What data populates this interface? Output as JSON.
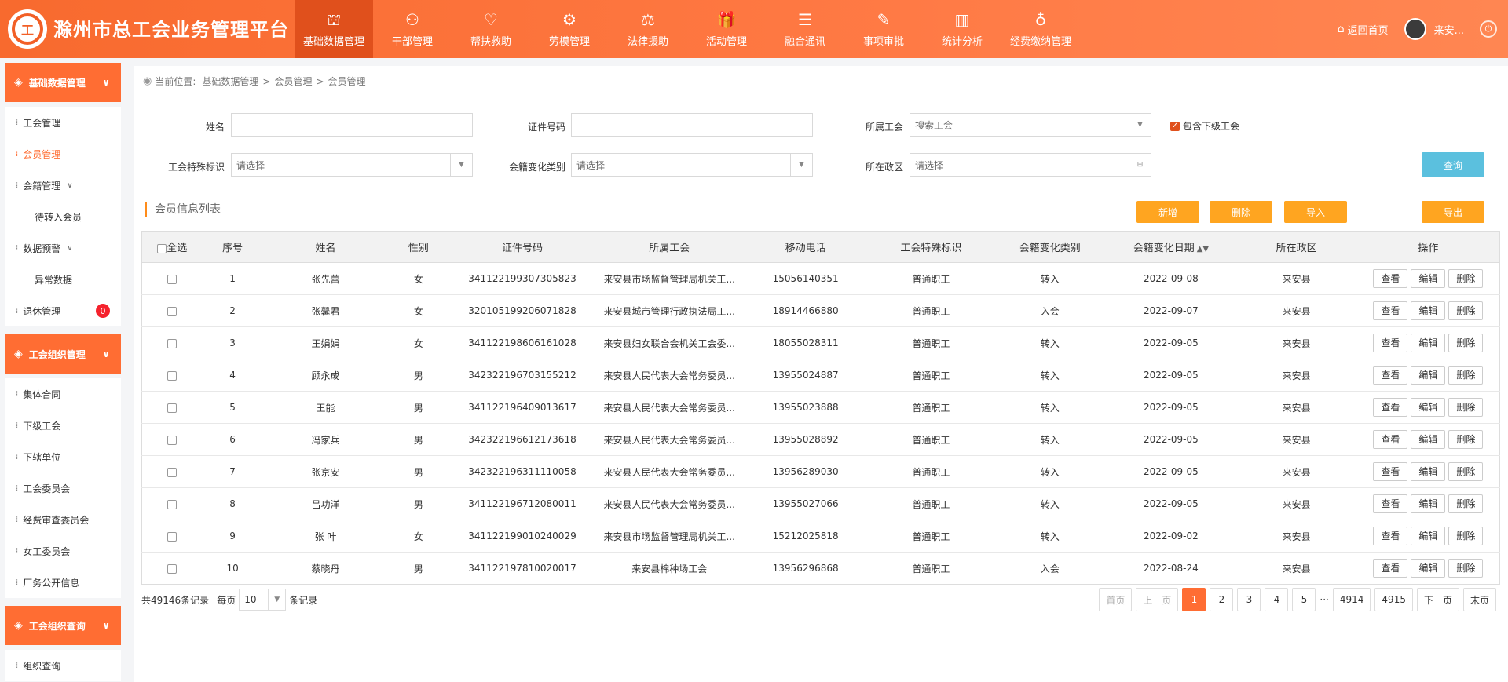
{
  "header": {
    "logo_char": "工",
    "title": "滁州市总工会业务管理平台",
    "nav": [
      {
        "label": "基础数据管理",
        "icon": "⛫",
        "active": true
      },
      {
        "label": "干部管理",
        "icon": "⚇"
      },
      {
        "label": "帮扶救助",
        "icon": "♡"
      },
      {
        "label": "劳模管理",
        "icon": "⚙"
      },
      {
        "label": "法律援助",
        "icon": "⚖"
      },
      {
        "label": "活动管理",
        "icon": "🎁"
      },
      {
        "label": "融合通讯",
        "icon": "☰"
      },
      {
        "label": "事项审批",
        "icon": "✎"
      },
      {
        "label": "统计分析",
        "icon": "▥"
      },
      {
        "label": "经费缴纳管理",
        "icon": "♁"
      }
    ],
    "home": "返回首页",
    "user": "来安...",
    "power_icon": "⏻"
  },
  "sidebar": {
    "groups": [
      {
        "title": "基础数据管理",
        "items": [
          {
            "label": "工会管理"
          },
          {
            "label": "会员管理",
            "active": true
          },
          {
            "label": "会籍管理",
            "expandable": true
          },
          {
            "label": "待转入会员",
            "sub": true
          },
          {
            "label": "数据预警",
            "expandable": true
          },
          {
            "label": "异常数据",
            "sub": true
          },
          {
            "label": "退休管理",
            "badge": "0"
          }
        ]
      },
      {
        "title": "工会组织管理",
        "items": [
          {
            "label": "集体合同"
          },
          {
            "label": "下级工会"
          },
          {
            "label": "下辖单位"
          },
          {
            "label": "工会委员会"
          },
          {
            "label": "经费审查委员会"
          },
          {
            "label": "女工委员会"
          },
          {
            "label": "厂务公开信息"
          }
        ]
      },
      {
        "title": "工会组织查询",
        "items": [
          {
            "label": "组织查询"
          }
        ]
      }
    ]
  },
  "breadcrumb": {
    "prefix": "当前位置:",
    "items": [
      "基础数据管理",
      "会员管理",
      "会员管理"
    ],
    "separator": ">"
  },
  "filters": {
    "name_label": "姓名",
    "id_label": "证件号码",
    "union_label": "所属工会",
    "union_placeholder": "搜索工会",
    "include_sub": "包含下级工会",
    "special_label": "工会特殊标识",
    "special_value": "请选择",
    "change_type_label": "会籍变化类别",
    "change_type_value": "请选择",
    "region_label": "所在政区",
    "region_value": "请选择",
    "query": "查询"
  },
  "list": {
    "title": "会员信息列表",
    "actions": [
      "新增",
      "删除",
      "导入",
      "导出"
    ]
  },
  "table": {
    "select_all": "全选",
    "columns": [
      "序号",
      "姓名",
      "性别",
      "证件号码",
      "所属工会",
      "移动电话",
      "工会特殊标识",
      "会籍变化类别",
      "会籍变化日期",
      "所在政区",
      "操作"
    ],
    "sort_icon": "▲▼",
    "row_actions": [
      "查看",
      "编辑",
      "删除"
    ],
    "rows": [
      [
        "1",
        "张先蕾",
        "女",
        "341122199307305823",
        "来安县市场监督管理局机关工...",
        "15056140351",
        "普通职工",
        "转入",
        "2022-09-08",
        "来安县"
      ],
      [
        "2",
        "张馨君",
        "女",
        "320105199206071828",
        "来安县城市管理行政执法局工...",
        "18914466880",
        "普通职工",
        "入会",
        "2022-09-07",
        "来安县"
      ],
      [
        "3",
        "王娟娟",
        "女",
        "341122198606161028",
        "来安县妇女联合会机关工会委...",
        "18055028311",
        "普通职工",
        "转入",
        "2022-09-05",
        "来安县"
      ],
      [
        "4",
        "顾永成",
        "男",
        "342322196703155212",
        "来安县人民代表大会常务委员...",
        "13955024887",
        "普通职工",
        "转入",
        "2022-09-05",
        "来安县"
      ],
      [
        "5",
        "王能",
        "男",
        "341122196409013617",
        "来安县人民代表大会常务委员...",
        "13955023888",
        "普通职工",
        "转入",
        "2022-09-05",
        "来安县"
      ],
      [
        "6",
        "冯家兵",
        "男",
        "342322196612173618",
        "来安县人民代表大会常务委员...",
        "13955028892",
        "普通职工",
        "转入",
        "2022-09-05",
        "来安县"
      ],
      [
        "7",
        "张京安",
        "男",
        "342322196311110058",
        "来安县人民代表大会常务委员...",
        "13956289030",
        "普通职工",
        "转入",
        "2022-09-05",
        "来安县"
      ],
      [
        "8",
        "吕功洋",
        "男",
        "341122196712080011",
        "来安县人民代表大会常务委员...",
        "13955027066",
        "普通职工",
        "转入",
        "2022-09-05",
        "来安县"
      ],
      [
        "9",
        "张 叶",
        "女",
        "341122199010240029",
        "来安县市场监督管理局机关工...",
        "15212025818",
        "普通职工",
        "转入",
        "2022-09-02",
        "来安县"
      ],
      [
        "10",
        "蔡晓丹",
        "男",
        "341122197810020017",
        "来安县棉种场工会",
        "13956296868",
        "普通职工",
        "入会",
        "2022-08-24",
        "来安县"
      ]
    ]
  },
  "pager": {
    "total_text": "共49146条记录",
    "per_page_label": "每页",
    "per_page_value": "10",
    "per_page_suffix": "条记录",
    "first": "首页",
    "prev": "上一页",
    "pages": [
      "1",
      "2",
      "3",
      "4",
      "5"
    ],
    "current": "1",
    "ellipsis": "···",
    "tail_pages": [
      "4914",
      "4915"
    ],
    "next": "下一页",
    "last": "末页"
  }
}
